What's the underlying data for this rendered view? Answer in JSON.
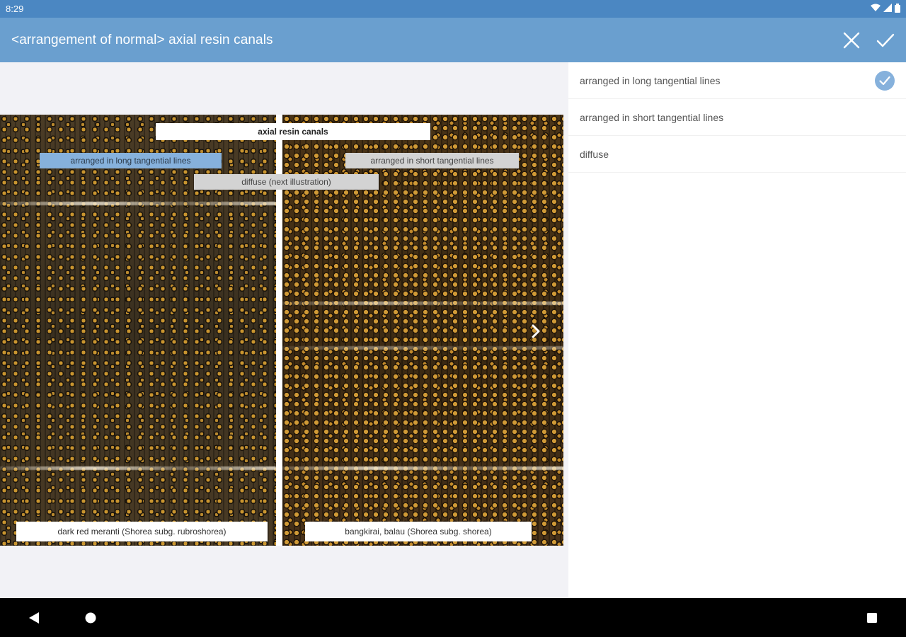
{
  "status_bar": {
    "time": "8:29",
    "icons": [
      "wifi-icon",
      "signal-icon",
      "battery-icon"
    ]
  },
  "app_bar": {
    "title": "<arrangement of normal> axial resin canals",
    "actions": [
      "close-icon",
      "check-icon"
    ]
  },
  "illustration": {
    "header": "axial resin canals",
    "label_long": "arranged in long tangential lines",
    "label_short": "arranged in short tangential lines",
    "label_diffuse": "diffuse (next illustration)",
    "caption_left": "dark red meranti (Shorea subg. rubroshorea)",
    "caption_right": "bangkirai, balau (Shorea subg. shorea)"
  },
  "options": [
    {
      "label": "arranged in long tangential lines",
      "selected": true
    },
    {
      "label": "arranged in short tangential lines",
      "selected": false
    },
    {
      "label": "diffuse",
      "selected": false
    }
  ],
  "colors": {
    "status_bar": "#4b87c2",
    "app_bar": "#6a9fcf",
    "selection": "#86b1dc"
  }
}
